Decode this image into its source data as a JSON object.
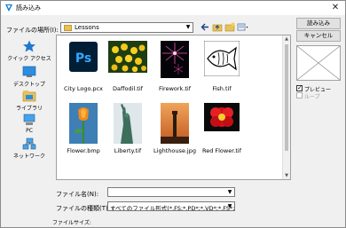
{
  "window": {
    "title": "読み込み",
    "close_glyph": "✕"
  },
  "look_in": {
    "label": "ファイルの場所(I):",
    "value": "Lessons"
  },
  "places": [
    {
      "label": "クイック アクセス",
      "icon": "star-icon"
    },
    {
      "label": "デスクトップ",
      "icon": "desktop-icon"
    },
    {
      "label": "ライブラリ",
      "icon": "library-icon"
    },
    {
      "label": "PC",
      "icon": "pc-icon"
    },
    {
      "label": "ネットワーク",
      "icon": "network-icon"
    }
  ],
  "files": [
    {
      "name": "City Logo.pcx",
      "kind": "photoshop"
    },
    {
      "name": "Daffodil.tif",
      "kind": "daffodil"
    },
    {
      "name": "Firework.tif",
      "kind": "firework"
    },
    {
      "name": "Fish.tif",
      "kind": "fish"
    },
    {
      "name": "Flower.bmp",
      "kind": "flower"
    },
    {
      "name": "Liberty.tif",
      "kind": "liberty"
    },
    {
      "name": "Lighthouse.jpg",
      "kind": "lighthouse"
    },
    {
      "name": "Red Flower.tif",
      "kind": "redflower"
    }
  ],
  "buttons": {
    "open": "読み込み",
    "cancel": "キャンセル"
  },
  "options": {
    "preview_label": "プレビュー",
    "preview_checked": true,
    "loop_label": "ループ",
    "loop_checked": false
  },
  "file_name": {
    "label": "ファイル名(N):",
    "value": ""
  },
  "file_type": {
    "label": "ファイルの種類(T):",
    "value": "すべてのファイル形式(*.FS;*.PD*;*.VD*;*.FS*;*.PD*;*.FD*;*.VD*)"
  },
  "file_size_label": "ファイルサイズ:",
  "colors": {
    "accent": "#0078d7",
    "photoshop_bg": "#001e36",
    "photoshop_fg": "#31a8ff"
  }
}
